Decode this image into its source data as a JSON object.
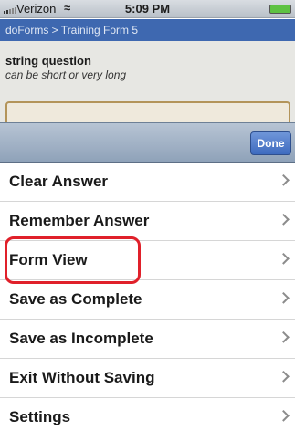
{
  "status_bar": {
    "carrier": "Verizon",
    "time": "5:09 PM"
  },
  "nav": {
    "breadcrumb": "doForms > Training Form 5"
  },
  "question": {
    "title": "string question",
    "hint": "can be short or very long"
  },
  "toolbar": {
    "done_label": "Done"
  },
  "menu": {
    "items": [
      {
        "label": "Clear Answer"
      },
      {
        "label": "Remember Answer"
      },
      {
        "label": "Form View"
      },
      {
        "label": "Save as Complete"
      },
      {
        "label": "Save as Incomplete"
      },
      {
        "label": "Exit Without Saving"
      },
      {
        "label": "Settings"
      }
    ]
  },
  "colors": {
    "nav_blue": "#3e68b0",
    "highlight_red": "#e0202a"
  }
}
